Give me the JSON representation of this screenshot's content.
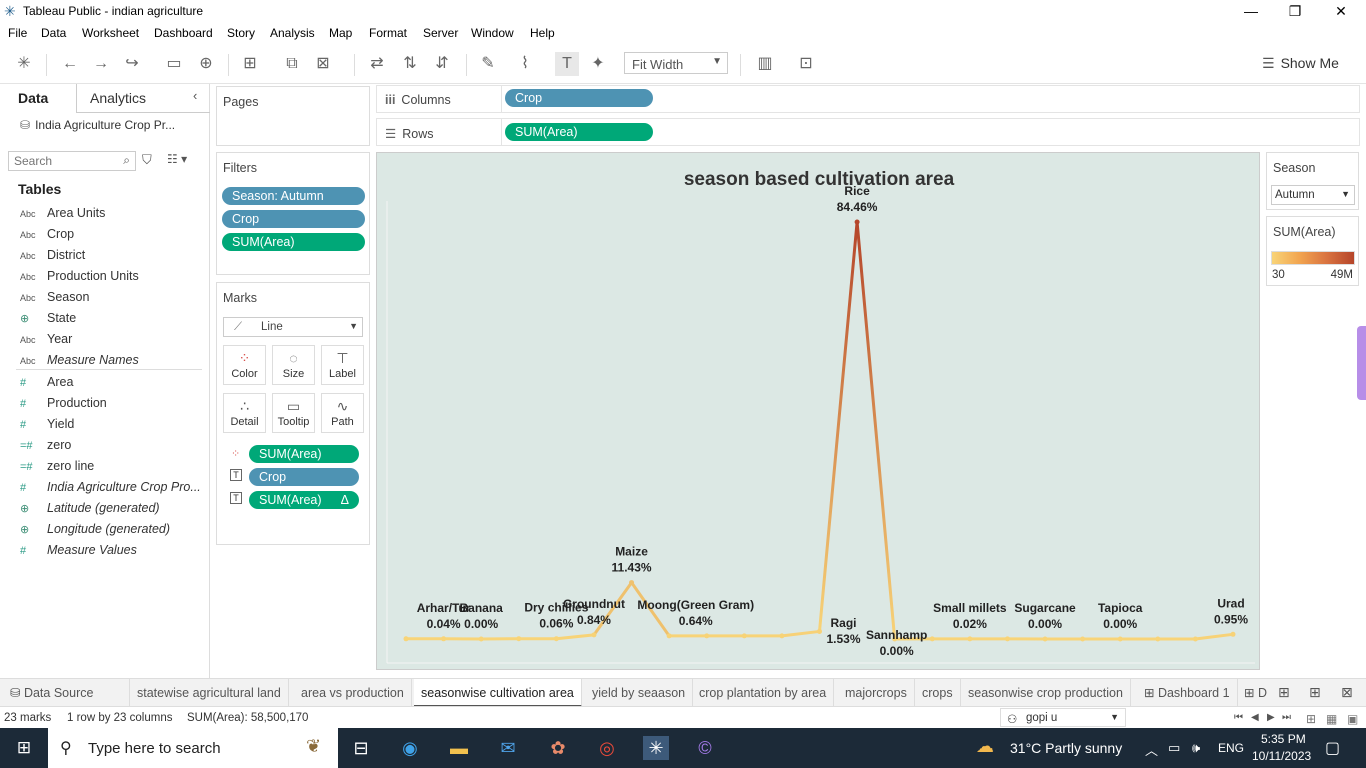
{
  "window": {
    "title": "Tableau Public - indian agriculture",
    "minimize": "—",
    "restore": "❐",
    "close": "✕"
  },
  "menu": [
    "File",
    "Data",
    "Worksheet",
    "Dashboard",
    "Story",
    "Analysis",
    "Map",
    "Format",
    "Server",
    "Window",
    "Help"
  ],
  "toolbar": {
    "fit": "Fit Width",
    "show_me": "Show Me"
  },
  "data_pane": {
    "tab_data": "Data",
    "tab_analytics": "Analytics",
    "datasource": "India Agriculture Crop Pr...",
    "search_placeholder": "Search",
    "tables_heading": "Tables",
    "dimensions": [
      {
        "type": "Abc",
        "name": "Area Units"
      },
      {
        "type": "Abc",
        "name": "Crop"
      },
      {
        "type": "Abc",
        "name": "District"
      },
      {
        "type": "Abc",
        "name": "Production Units"
      },
      {
        "type": "Abc",
        "name": "Season"
      },
      {
        "type": "geo",
        "name": "State"
      },
      {
        "type": "Abc",
        "name": "Year"
      },
      {
        "type": "Abc",
        "name": "Measure Names",
        "italic": true
      }
    ],
    "measures": [
      {
        "type": "#",
        "name": "Area"
      },
      {
        "type": "#",
        "name": "Production"
      },
      {
        "type": "#",
        "name": "Yield"
      },
      {
        "type": "=#",
        "name": "zero"
      },
      {
        "type": "=#",
        "name": "zero line"
      },
      {
        "type": "#",
        "name": "India Agriculture Crop Pro...",
        "italic": true
      },
      {
        "type": "geo",
        "name": "Latitude (generated)",
        "italic": true
      },
      {
        "type": "geo",
        "name": "Longitude (generated)",
        "italic": true
      },
      {
        "type": "#",
        "name": "Measure Values",
        "italic": true
      }
    ]
  },
  "pages": {
    "title": "Pages"
  },
  "filters": {
    "title": "Filters",
    "pills": [
      "Season: Autumn",
      "Crop",
      "SUM(Area)"
    ]
  },
  "marks": {
    "title": "Marks",
    "type": "Line",
    "buttons": [
      "Color",
      "Size",
      "Label",
      "Detail",
      "Tooltip",
      "Path"
    ],
    "pills": [
      "SUM(Area)",
      "Crop",
      "SUM(Area)"
    ],
    "delta": "Δ"
  },
  "shelves": {
    "columns_label": "Columns",
    "columns_pill": "Crop",
    "rows_label": "Rows",
    "rows_pill": "SUM(Area)"
  },
  "legend": {
    "season_title": "Season",
    "season_value": "Autumn",
    "sum_title": "SUM(Area)",
    "min": "30",
    "max": "49M",
    "colors": {
      "low": "#f8d478",
      "high": "#b5452a"
    }
  },
  "chart_data": {
    "type": "line",
    "title": "season based cultivation area",
    "categories": [
      "Arhar/Tur",
      "Banana",
      "Dry chillies",
      "Groundnut",
      "Maize",
      "Moong(Green Gram)",
      "Ragi",
      "Sannhamp",
      "Small millets",
      "Sugarcane",
      "Tapioca",
      "Urad"
    ],
    "point_count": 23,
    "values_pct": [
      0.04,
      0.04,
      0.0,
      0.06,
      0.06,
      0.84,
      11.43,
      0.64,
      0.64,
      0.64,
      0.64,
      1.53,
      84.46,
      0.0,
      0.02,
      0.02,
      0.02,
      0.0,
      0.0,
      0.0,
      0.0,
      0.0,
      0.95
    ],
    "labels": [
      {
        "idx": 1,
        "name": "Arhar/Tur",
        "pct": "0.04%"
      },
      {
        "idx": 2,
        "name": "Banana",
        "pct": "0.00%"
      },
      {
        "idx": 4,
        "name": "Dry chillies",
        "pct": "0.06%"
      },
      {
        "idx": 5,
        "name": "Groundnut",
        "pct": "0.84%"
      },
      {
        "idx": 6,
        "name": "Maize",
        "pct": "11.43%"
      },
      {
        "idx": 8,
        "name": "Moong(Green Gram)",
        "pct": "0.64%"
      },
      {
        "idx": 11,
        "name": "Ragi",
        "pct": "1.53%"
      },
      {
        "idx": 12,
        "name": "Rice",
        "pct": "84.46%"
      },
      {
        "idx": 13,
        "name": "Sannhamp",
        "pct": "0.00%"
      },
      {
        "idx": 15,
        "name": "Small millets",
        "pct": "0.02%"
      },
      {
        "idx": 17,
        "name": "Sugarcane",
        "pct": "0.00%"
      },
      {
        "idx": 19,
        "name": "Tapioca",
        "pct": "0.00%"
      },
      {
        "idx": 22,
        "name": "Urad",
        "pct": "0.95%"
      }
    ],
    "ylim": [
      0,
      84.46
    ],
    "grid": false,
    "color_low": "#f8d478",
    "color_high": "#b5452a"
  },
  "sheet_tabs": {
    "data_source": "Data Source",
    "tabs": [
      "statewise agricultural land",
      "area vs production",
      "seasonwise cultivation area",
      "yield by seaason",
      "crop plantation by area",
      "majorcrops",
      "crops",
      "seasonwise crop production",
      "Dashboard 1"
    ],
    "active": "seasonwise cultivation area",
    "truncated": "D"
  },
  "status": {
    "marks": "23 marks",
    "dims": "1 row by 23 columns",
    "sum": "SUM(Area): 58,500,170",
    "user": "gopi u"
  },
  "taskbar": {
    "search": "Type here to search",
    "weather": "31°C  Partly sunny",
    "lang": "ENG",
    "time": "5:35 PM",
    "date": "10/11/2023"
  }
}
